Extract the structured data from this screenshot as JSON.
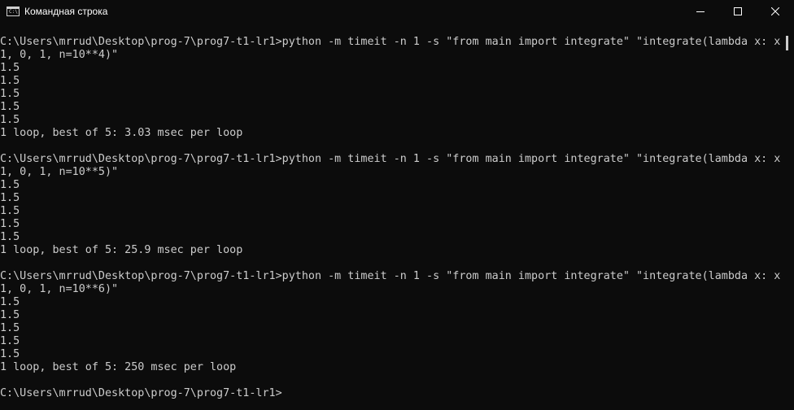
{
  "window": {
    "title": "Командная строка",
    "icon": "cmd-icon",
    "controls": [
      "minimize-icon",
      "maximize-icon",
      "close-icon"
    ]
  },
  "console": {
    "lines": [
      "C:\\Users\\mrrud\\Desktop\\prog-7\\prog7-t1-lr1>python -m timeit -n 1 -s \"from main import integrate\" \"integrate(lambda x: x+",
      "1, 0, 1, n=10**4)\"",
      "1.5",
      "1.5",
      "1.5",
      "1.5",
      "1.5",
      "1 loop, best of 5: 3.03 msec per loop",
      "",
      "C:\\Users\\mrrud\\Desktop\\prog-7\\prog7-t1-lr1>python -m timeit -n 1 -s \"from main import integrate\" \"integrate(lambda x: x+",
      "1, 0, 1, n=10**5)\"",
      "1.5",
      "1.5",
      "1.5",
      "1.5",
      "1.5",
      "1 loop, best of 5: 25.9 msec per loop",
      "",
      "C:\\Users\\mrrud\\Desktop\\prog-7\\prog7-t1-lr1>python -m timeit -n 1 -s \"from main import integrate\" \"integrate(lambda x: x+",
      "1, 0, 1, n=10**6)\"",
      "1.5",
      "1.5",
      "1.5",
      "1.5",
      "1.5",
      "1 loop, best of 5: 250 msec per loop",
      "",
      "C:\\Users\\mrrud\\Desktop\\prog-7\\prog7-t1-lr1>"
    ]
  },
  "colors": {
    "background": "#0c0c0c",
    "text": "#cccccc",
    "title_text": "#ffffff"
  }
}
